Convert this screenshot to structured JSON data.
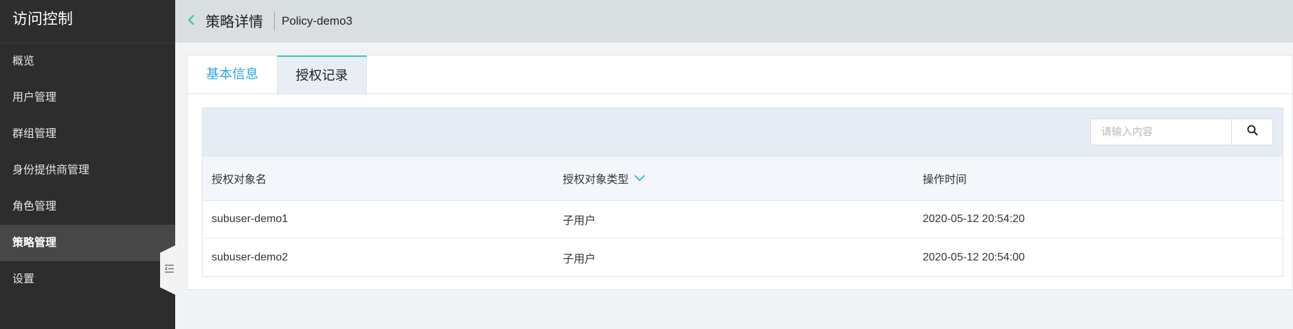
{
  "sidebar": {
    "title": "访问控制",
    "items": [
      {
        "label": "概览",
        "active": false
      },
      {
        "label": "用户管理",
        "active": false
      },
      {
        "label": "群组管理",
        "active": false
      },
      {
        "label": "身份提供商管理",
        "active": false
      },
      {
        "label": "角色管理",
        "active": false
      },
      {
        "label": "策略管理",
        "active": true
      },
      {
        "label": "设置",
        "active": false
      }
    ],
    "collapse_icon": "collapse-menu-icon"
  },
  "header": {
    "back_icon": "chevron-left-icon",
    "title": "策略详情",
    "subtitle": "Policy-demo3"
  },
  "tabs": [
    {
      "label": "基本信息",
      "active": false
    },
    {
      "label": "授权记录",
      "active": true
    }
  ],
  "search": {
    "placeholder": "请输入内容",
    "value": "",
    "icon": "search-icon"
  },
  "table": {
    "columns": [
      "授权对象名",
      "授权对象类型",
      "操作时间"
    ],
    "rows": [
      [
        "subuser-demo1",
        "子用户",
        "2020-05-12 20:54:20"
      ],
      [
        "subuser-demo2",
        "子用户",
        "2020-05-12 20:54:00"
      ]
    ]
  },
  "colors": {
    "sidebar_bg": "#2d2d2d",
    "header_bg": "#d9dee0",
    "accent_blue": "#2fa8e0",
    "accent_teal": "#3cc8b4"
  }
}
